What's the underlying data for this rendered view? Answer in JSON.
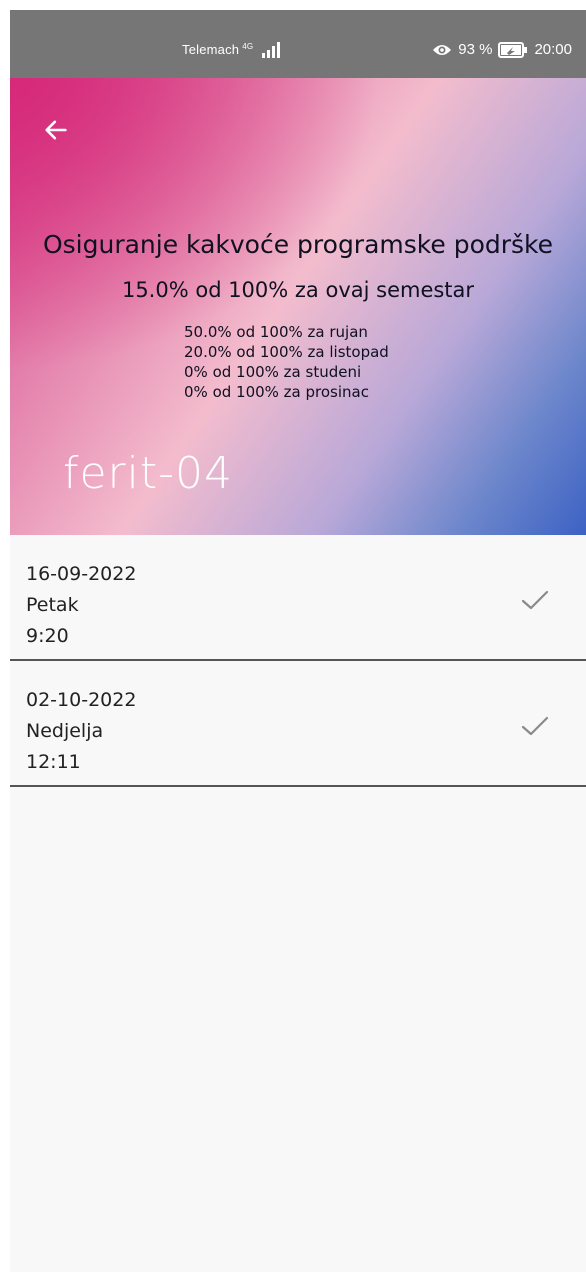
{
  "status_bar": {
    "carrier": "Telemach",
    "network_type": "4G",
    "battery_percent": "93 %",
    "time": "20:00",
    "icons": [
      "signal-icon",
      "eye-icon",
      "battery-icon"
    ]
  },
  "header": {
    "back_icon": "arrow-left-icon",
    "course_title": "Osiguranje kakvoće programske podrške",
    "semester_summary": "15.0% od 100% za ovaj semestar",
    "months": [
      "50.0% od 100% za rujan",
      "20.0% od 100% za listopad",
      "0% od 100% za studeni",
      "0% od 100% za prosinac"
    ],
    "device_name": "ferit-04"
  },
  "entries": [
    {
      "date": "16-09-2022",
      "day": "Petak",
      "time": "9:20",
      "status_icon": "check-icon"
    },
    {
      "date": "02-10-2022",
      "day": "Nedjelja",
      "time": "12:11",
      "status_icon": "check-icon"
    }
  ],
  "colors": {
    "status_bar": "#767676",
    "gradient_pink": "#d63a88",
    "gradient_blue": "#3c62c4",
    "list_background": "#f8f8f8",
    "divider": "#555555"
  }
}
